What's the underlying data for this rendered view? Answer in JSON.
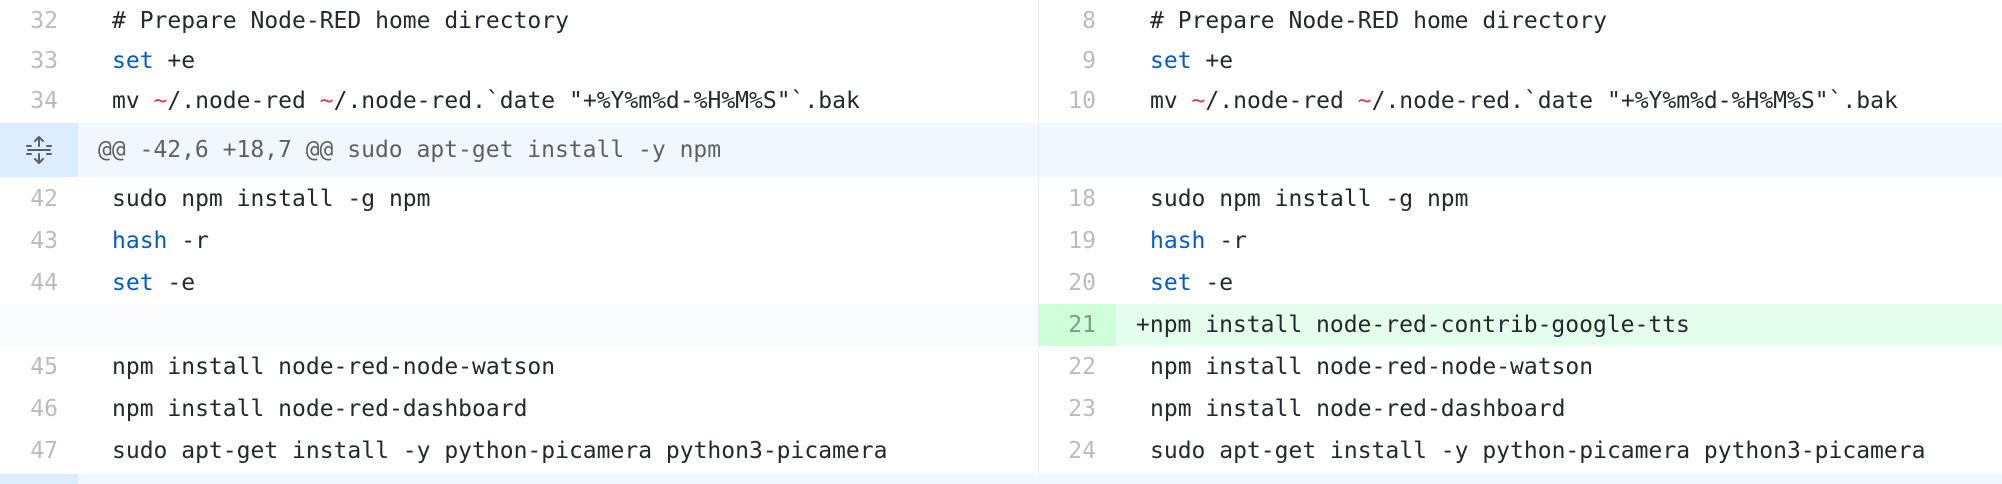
{
  "colors": {
    "keyword": "#005cc5",
    "tilde": "#d73a49",
    "hunk_bg": "#f1f8ff",
    "added_bg": "#e6ffed",
    "added_num_bg": "#cdffd8"
  },
  "icons": {
    "expand": "unfold-icon"
  },
  "rows": {
    "r1": {
      "left_num": "32",
      "left_text": "# Prepare Node-RED home directory",
      "right_num": "8",
      "right_text": "# Prepare Node-RED home directory"
    },
    "r2": {
      "left_num": "33",
      "left_kw": "set",
      "left_rest": " +e",
      "right_num": "9",
      "right_kw": "set",
      "right_rest": " +e"
    },
    "r3": {
      "left_num": "34",
      "left_a": "mv ",
      "left_t1": "~",
      "left_b": "/.node-red ",
      "left_t2": "~",
      "left_c": "/.node-red.`date \"+%Y%m%d-%H%M%S\"`.bak",
      "right_num": "10",
      "right_a": "mv ",
      "right_t1": "~",
      "right_b": "/.node-red ",
      "right_t2": "~",
      "right_c": "/.node-red.`date \"+%Y%m%d-%H%M%S\"`.bak"
    },
    "hunk": "@@ -42,6 +18,7 @@ sudo apt-get install -y npm",
    "r4": {
      "left_num": "42",
      "left_text": "sudo npm install -g npm",
      "right_num": "18",
      "right_text": "sudo npm install -g npm"
    },
    "r5": {
      "left_num": "43",
      "left_kw": "hash",
      "left_rest": " -r",
      "right_num": "19",
      "right_kw": "hash",
      "right_rest": " -r"
    },
    "r6": {
      "left_num": "44",
      "left_kw": "set",
      "left_rest": " -e",
      "right_num": "20",
      "right_kw": "set",
      "right_rest": " -e"
    },
    "r7": {
      "right_num": "21",
      "right_text": "+npm install node-red-contrib-google-tts"
    },
    "r8": {
      "left_num": "45",
      "left_text": "npm install node-red-node-watson",
      "right_num": "22",
      "right_text": "npm install node-red-node-watson"
    },
    "r9": {
      "left_num": "46",
      "left_text": "npm install node-red-dashboard",
      "right_num": "23",
      "right_text": "npm install node-red-dashboard"
    },
    "r10": {
      "left_num": "47",
      "left_text": "sudo apt-get install -y python-picamera python3-picamera",
      "right_num": "24",
      "right_text": "sudo apt-get install -y python-picamera python3-picamera"
    }
  }
}
